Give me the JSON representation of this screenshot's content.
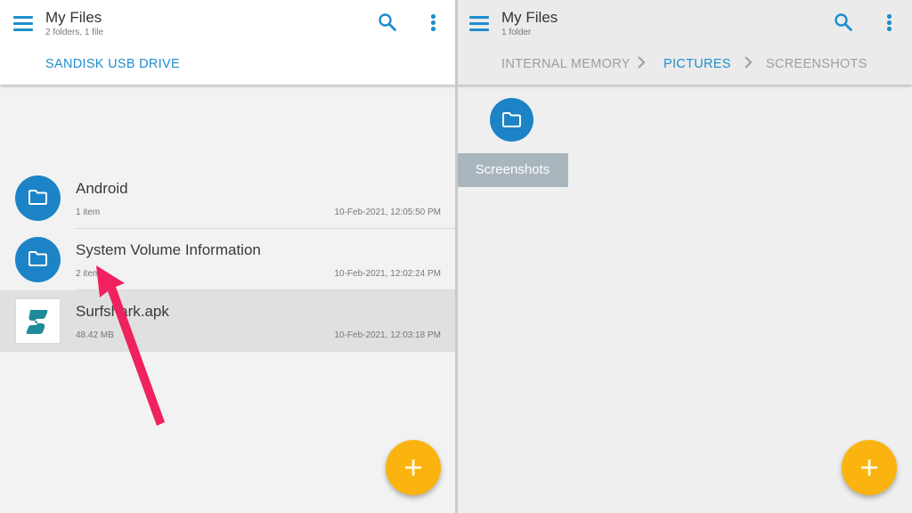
{
  "colors": {
    "accent": "#1f8ece",
    "folder": "#1c84c6",
    "fab": "#fbb40f",
    "arrow": "#f0215f",
    "surfshark": "#1f8b9a"
  },
  "left": {
    "title": "My Files",
    "subtitle": "2 folders, 1 file",
    "breadcrumb": [
      "SANDISK USB DRIVE"
    ],
    "items": [
      {
        "name": "Android",
        "meta": "1 item",
        "date": "10-Feb-2021, 12:05:50 PM",
        "icon": "folder-icon"
      },
      {
        "name": "System Volume Information",
        "meta": "2 items",
        "date": "10-Feb-2021, 12:02:24 PM",
        "icon": "folder-icon"
      },
      {
        "name": "Surfshark.apk",
        "meta": "48.42 MB",
        "date": "10-Feb-2021, 12:03:18 PM",
        "icon": "surfshark-logo-icon",
        "selected": true
      }
    ],
    "fab_icon": "plus-icon"
  },
  "right": {
    "title": "My Files",
    "subtitle": "1 folder",
    "breadcrumb": [
      "INTERNAL MEMORY",
      "PICTURES",
      "SCREENSHOTS"
    ],
    "grid_items": [
      {
        "name": "Screenshots",
        "icon": "folder-icon"
      }
    ],
    "fab_icon": "plus-icon"
  }
}
